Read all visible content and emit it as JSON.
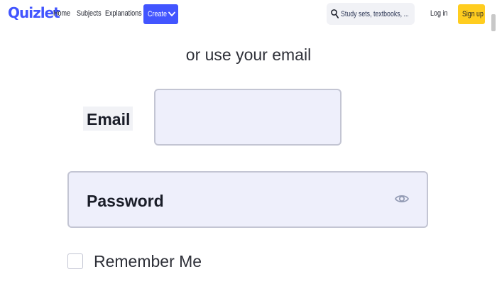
{
  "header": {
    "logo": "Quizlet",
    "nav": [
      {
        "label": "Home"
      },
      {
        "label": "Subjects"
      },
      {
        "label": "Explanations"
      }
    ],
    "create_label": "Create",
    "search": {
      "placeholder": "Study sets, textbooks, ..."
    },
    "login_label": "Log in",
    "signup_label": "Sign up"
  },
  "form": {
    "subtitle": "or use your email",
    "email_label": "Email",
    "email_value": "",
    "password_label": "Password",
    "remember_label": "Remember Me",
    "remember_checked": false
  },
  "colors": {
    "brand": "#4255ff",
    "signup": "#ffcd1f",
    "input_bg": "#eeeffb",
    "input_border": "#c3c5d3"
  },
  "icons": {
    "create_chevron": "chevron-down-icon",
    "search": "search-icon",
    "password_toggle": "eye-icon"
  }
}
